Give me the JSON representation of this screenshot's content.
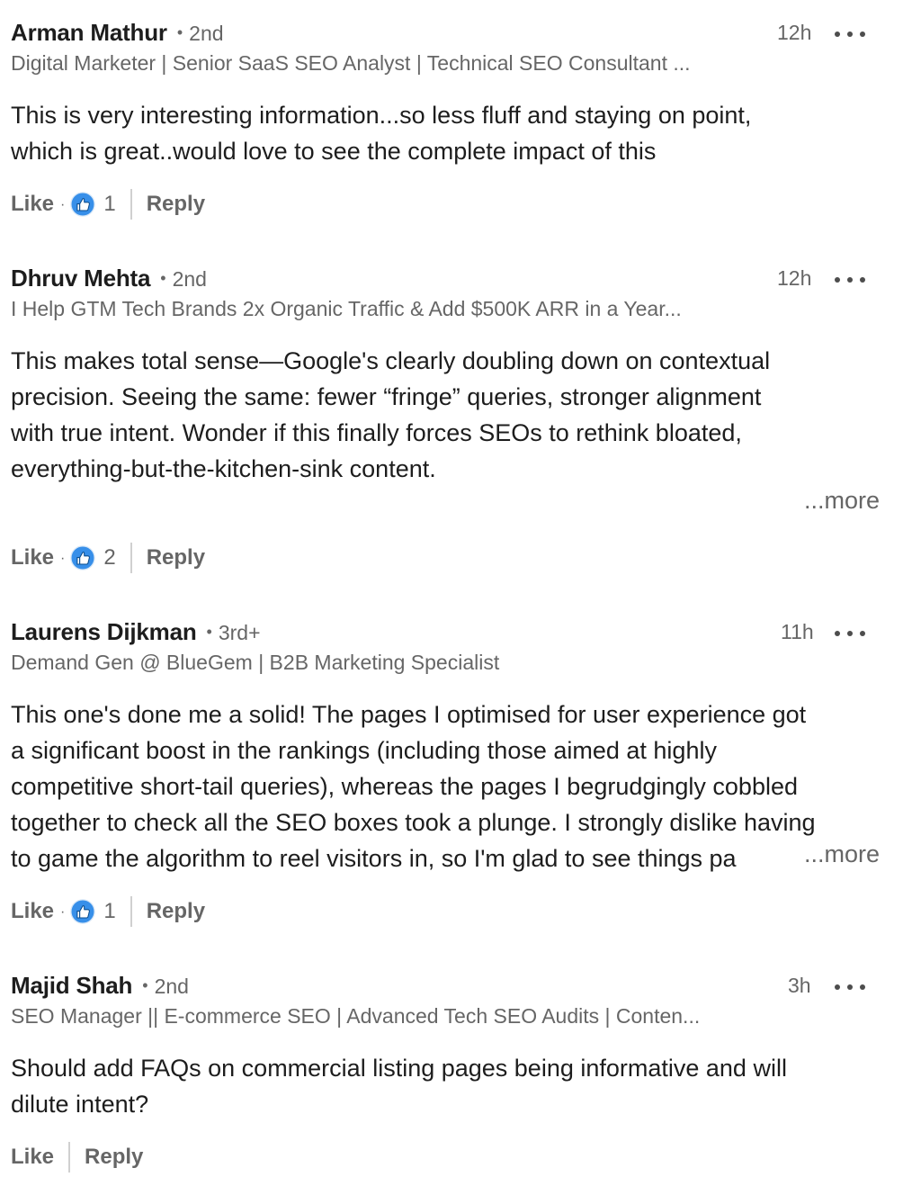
{
  "comments": [
    {
      "name": "Arman Mathur",
      "separator": "•",
      "degree": "2nd",
      "time": "12h",
      "headline": "Digital Marketer | Senior SaaS SEO Analyst | Technical SEO Consultant ...",
      "body": [
        "This is very interesting information...so less fluff and staying on point,",
        "which is great..would love to see the complete impact of this"
      ],
      "like_label": "Like",
      "dot": "·",
      "reaction_icon": "like-thumb-icon",
      "reaction_count": "1",
      "reply_label": "Reply"
    },
    {
      "name": "Dhruv Mehta",
      "separator": "•",
      "degree": "2nd",
      "time": "12h",
      "headline": "I Help GTM Tech Brands 2x Organic Traffic & Add $500K ARR in a Year...",
      "body": [
        "This makes total sense—Google's clearly doubling down on contextual",
        "precision. Seeing the same: fewer “fringe” queries, stronger alignment",
        "with true intent. Wonder if this finally forces SEOs to rethink bloated,",
        "everything-but-the-kitchen-sink content."
      ],
      "more_label": "...more",
      "like_label": "Like",
      "dot": "·",
      "reaction_icon": "like-thumb-icon",
      "reaction_count": "2",
      "reply_label": "Reply"
    },
    {
      "name": "Laurens Dijkman",
      "separator": "•",
      "degree": "3rd+",
      "time": "11h",
      "headline": "Demand Gen @ BlueGem | B2B Marketing Specialist",
      "body": [
        "This one's done me a solid! The pages I optimised for user experience got",
        "a significant boost in the rankings (including those aimed at highly",
        "competitive short-tail queries), whereas the pages I begrudgingly cobbled",
        "together to check all the SEO boxes took a plunge. I strongly dislike having",
        "to game the algorithm to reel visitors in, so I'm glad to see things pa"
      ],
      "more_label": "...more",
      "like_label": "Like",
      "dot": "·",
      "reaction_icon": "like-thumb-icon",
      "reaction_count": "1",
      "reply_label": "Reply"
    },
    {
      "name": "Majid Shah",
      "separator": "•",
      "degree": "2nd",
      "time": "3h",
      "headline": "SEO Manager || E-commerce SEO | Advanced Tech SEO Audits | Conten...",
      "body": [
        "Should add FAQs on commercial listing pages being informative and will",
        "dilute intent?"
      ],
      "like_label": "Like",
      "reply_label": "Reply"
    }
  ],
  "colors": {
    "text": "#1d1d1d",
    "muted": "#666666",
    "divider": "#d0d0d0",
    "like_blue": "#378fe9",
    "like_outline": "#0a66c2"
  }
}
